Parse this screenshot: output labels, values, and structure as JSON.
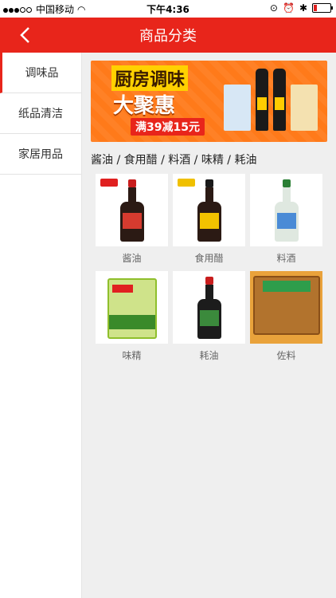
{
  "status": {
    "carrier": "中国移动",
    "time": "下午4:36",
    "battery_level": 0.2
  },
  "nav": {
    "title": "商品分类"
  },
  "sidebar": {
    "items": [
      {
        "label": "调味品",
        "active": true
      },
      {
        "label": "纸品清洁",
        "active": false
      },
      {
        "label": "家居用品",
        "active": false
      }
    ]
  },
  "banner": {
    "line1": "厨房调味",
    "line2": "大聚惠",
    "line3": "满39减15元"
  },
  "breadcrumb": "酱油 / 食用醋 / 料酒 / 味精 / 耗油",
  "products": [
    {
      "label": "酱油"
    },
    {
      "label": "食用醋"
    },
    {
      "label": "料酒"
    },
    {
      "label": "味精"
    },
    {
      "label": "耗油"
    },
    {
      "label": "佐料"
    }
  ],
  "colors": {
    "accent": "#e8251b",
    "banner": "#ff7a1a"
  }
}
